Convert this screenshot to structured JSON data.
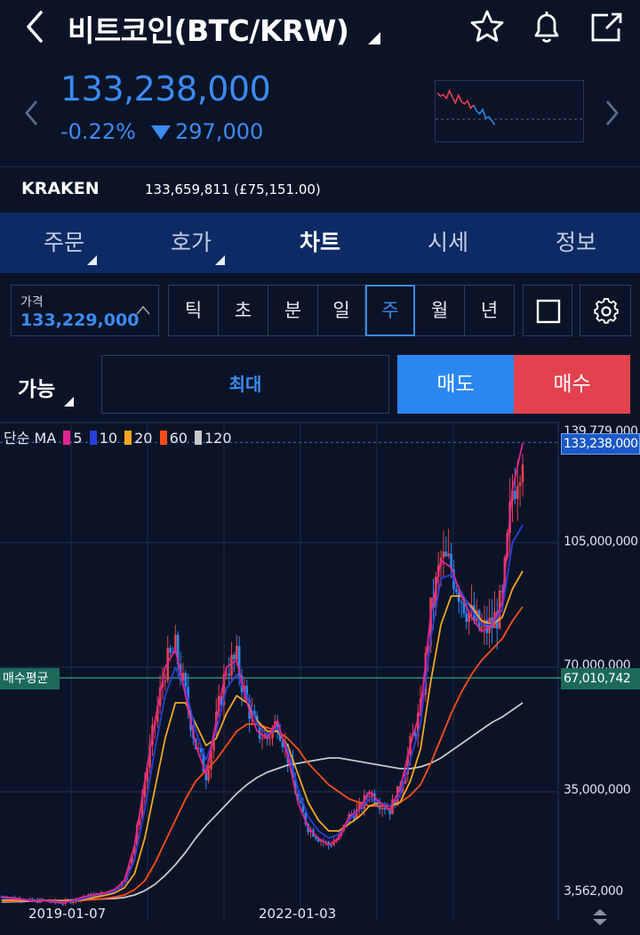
{
  "header": {
    "title": "비트코인(BTC/KRW)"
  },
  "quote": {
    "price": "133,238,000",
    "change_pct": "-0.22%",
    "change_val": "297,000"
  },
  "exchange": {
    "name": "KRAKEN",
    "ref_price": "133,659,811 (£75,151.00)"
  },
  "tabs": [
    {
      "label": "주문"
    },
    {
      "label": "호가"
    },
    {
      "label": "차트"
    },
    {
      "label": "시세"
    },
    {
      "label": "정보"
    }
  ],
  "controls": {
    "price_label": "가격",
    "price_value": "133,229,000",
    "periods": [
      "틱",
      "초",
      "분",
      "일",
      "주",
      "월",
      "년"
    ],
    "active_period": "주"
  },
  "order": {
    "avail_label": "가능",
    "max_label": "최대",
    "sell_label": "매도",
    "buy_label": "매수"
  },
  "colors": {
    "up": "#e3414e",
    "down": "#2b87f0",
    "accent": "#3b8bf2",
    "ma5": "#e0248f",
    "ma10": "#2a3fd8",
    "ma20": "#f5a623",
    "ma60": "#ff4d1a",
    "ma120": "#c8c8c8",
    "avg_line": "#2a8c7a"
  },
  "chart_data": {
    "type": "line",
    "legend_prefix": "단순 MA",
    "legend": [
      {
        "name": "5",
        "color": "#e0248f"
      },
      {
        "name": "10",
        "color": "#2a3fd8"
      },
      {
        "name": "20",
        "color": "#f5a623"
      },
      {
        "name": "60",
        "color": "#ff4d1a"
      },
      {
        "name": "120",
        "color": "#c8c8c8"
      }
    ],
    "y_ticks": [
      "105,000,000",
      "70,000,000",
      "35,000,000",
      "3,562,000"
    ],
    "y_top_label": "139,779,000",
    "current_price_tag": "133,238,000",
    "avg_buy_label": "매수평균",
    "avg_buy_value": "67,010,742",
    "x_ticks": [
      "2019-01-07",
      "2022-01-03"
    ],
    "ylim": [
      3562000,
      139779000
    ],
    "ma": {
      "ma5": [
        5.5,
        5.2,
        4.8,
        4.2,
        4.5,
        4.0,
        3.8,
        4.5,
        5.5,
        6.0,
        6.5,
        7.5,
        10,
        20,
        38,
        55,
        70,
        75,
        62,
        48,
        40,
        55,
        70,
        72,
        60,
        52,
        50,
        55,
        45,
        32,
        25,
        22,
        20,
        22,
        28,
        30,
        35,
        32,
        30,
        36,
        48,
        58,
        85,
        100,
        98,
        90,
        84,
        80,
        82,
        88,
        120,
        133
      ],
      "ma10": [
        5.0,
        5.0,
        4.8,
        4.5,
        4.4,
        4.2,
        4.0,
        4.3,
        5.0,
        5.8,
        6.3,
        7.0,
        9,
        16,
        30,
        47,
        62,
        70,
        64,
        52,
        44,
        52,
        64,
        68,
        62,
        54,
        51,
        53,
        47,
        36,
        28,
        24,
        22,
        23,
        27,
        30,
        33,
        32,
        31,
        34,
        44,
        54,
        78,
        95,
        96,
        91,
        86,
        82,
        82,
        86,
        105,
        110
      ],
      "ma20": [
        4.5,
        4.6,
        4.6,
        4.5,
        4.4,
        4.3,
        4.2,
        4.3,
        4.7,
        5.3,
        5.8,
        6.5,
        8,
        12,
        22,
        36,
        50,
        60,
        60,
        54,
        48,
        50,
        57,
        62,
        60,
        55,
        52,
        52,
        48,
        40,
        32,
        27,
        24,
        24,
        26,
        28,
        31,
        32,
        31,
        32,
        38,
        47,
        66,
        82,
        90,
        90,
        87,
        83,
        82,
        84,
        92,
        97
      ],
      "ma60": [
        4.2,
        4.3,
        4.4,
        4.5,
        4.5,
        4.5,
        4.4,
        4.4,
        4.5,
        4.7,
        5.0,
        5.4,
        6,
        7.5,
        10,
        15,
        21,
        27,
        33,
        38,
        41,
        44,
        48,
        52,
        54,
        54,
        53,
        52,
        50,
        47,
        43,
        40,
        37,
        35,
        33,
        32,
        31,
        31,
        31,
        32,
        34,
        37,
        43,
        50,
        57,
        63,
        68,
        72,
        75,
        78,
        83,
        87
      ],
      "ma120": [
        4.0,
        4.1,
        4.2,
        4.3,
        4.4,
        4.5,
        4.5,
        4.6,
        4.7,
        4.8,
        4.9,
        5.0,
        5.3,
        6.0,
        7.2,
        9,
        11.5,
        14.5,
        18,
        22,
        25.5,
        28.5,
        31.5,
        34.5,
        37,
        39,
        40.5,
        41.5,
        42.5,
        43,
        43.5,
        44,
        44.5,
        44.5,
        44,
        43.5,
        43,
        42.5,
        42,
        41.5,
        41.5,
        42,
        43,
        44.5,
        46.5,
        48.5,
        50.5,
        52.5,
        54.5,
        56,
        58,
        60
      ]
    }
  },
  "mini_chart": {
    "values": [
      88,
      82,
      85,
      78,
      92,
      80,
      70,
      84,
      72,
      68,
      74,
      60,
      66,
      55,
      50,
      58,
      42,
      45,
      38,
      30
    ]
  }
}
